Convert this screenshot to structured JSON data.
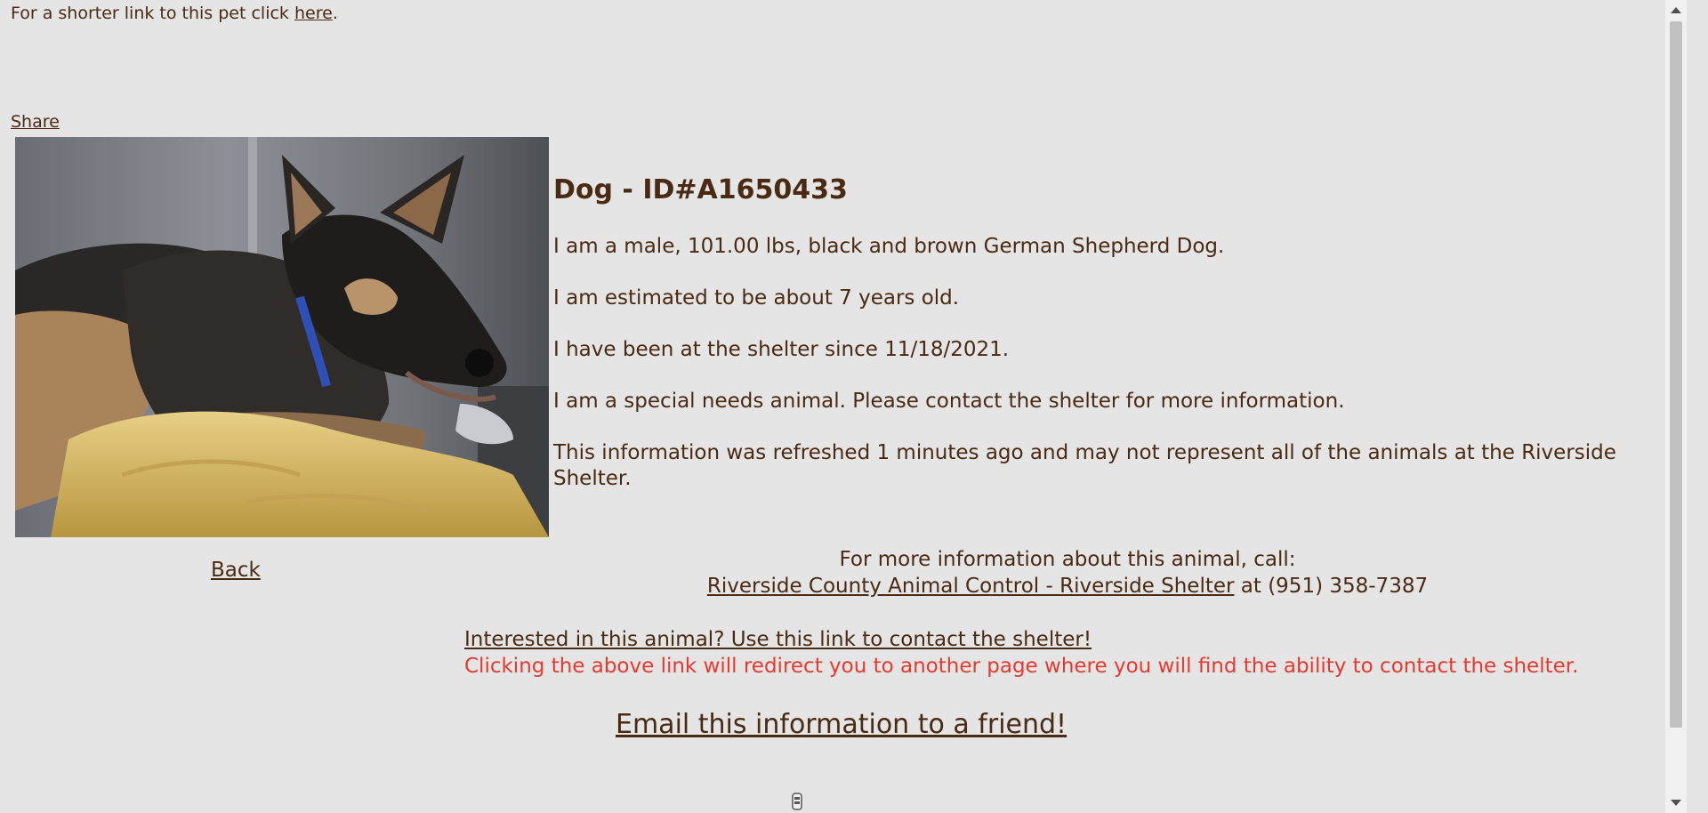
{
  "shortlink": {
    "prefix": "For a shorter link to this pet click ",
    "link": "here",
    "suffix": "."
  },
  "share_label": "Share",
  "photo": {
    "icon": "dog-photo"
  },
  "back_label": "Back",
  "animal": {
    "title": "Dog - ID#A1650433",
    "lines": [
      "I am a male, 101.00 lbs, black and brown German Shepherd Dog.",
      "I am estimated to be about 7 years old.",
      "I have been at the shelter since 11/18/2021.",
      "I am a special needs animal. Please contact the shelter for more information.",
      "This information was refreshed 1 minutes ago and may not represent all of the animals at the Riverside Shelter."
    ]
  },
  "call": {
    "heading": "For more information about this animal, call:",
    "shelter_link": "Riverside County Animal Control - Riverside Shelter",
    "connector": " at ",
    "phone": "(951) 358-7387"
  },
  "contact": {
    "link": "Interested in this animal? Use this link to contact the shelter!",
    "warning": "Clicking the above link will redirect you to another page where you will find the ability to contact the shelter."
  },
  "email_label": "Email this information to a friend!",
  "colors": {
    "background": "#e5e5e5",
    "text": "#4a2a12",
    "warning": "#e53a30"
  }
}
